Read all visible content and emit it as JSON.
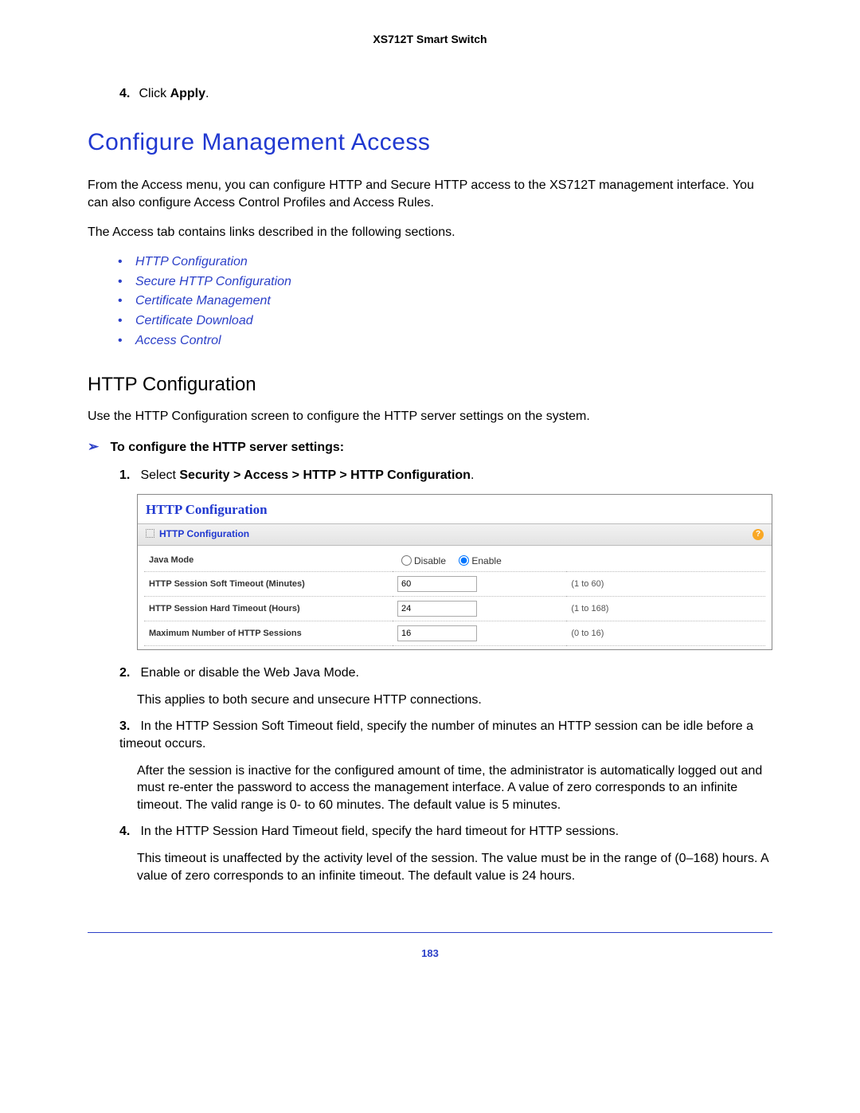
{
  "header": {
    "product": "XS712T Smart Switch"
  },
  "top_step": {
    "num": "4.",
    "prefix": "Click ",
    "bold": "Apply",
    "suffix": "."
  },
  "section_title": "Configure Management Access",
  "intro_para1": "From the Access menu, you can configure HTTP and Secure HTTP access to the XS712T management interface. You can also configure Access Control Profiles and Access Rules.",
  "intro_para2": "The Access tab contains links described in the following sections.",
  "access_links": [
    "HTTP Configuration",
    "Secure HTTP Configuration",
    "Certificate Management",
    "Certificate Download",
    "Access Control"
  ],
  "subsection_title": "HTTP Configuration",
  "sub_intro": "Use the HTTP Configuration screen to configure the HTTP server settings on the system.",
  "proc_heading": "To configure the HTTP server settings:",
  "step1": {
    "num": "1.",
    "prefix": "Select ",
    "bold": "Security > Access > HTTP > HTTP Configuration",
    "suffix": "."
  },
  "panel": {
    "title": "HTTP Configuration",
    "subtitle": "HTTP Configuration",
    "help_glyph": "?",
    "rows": {
      "java": {
        "label": "Java Mode",
        "disable": "Disable",
        "enable": "Enable",
        "selected": "enable"
      },
      "soft": {
        "label": "HTTP Session Soft Timeout (Minutes)",
        "value": "60",
        "range": "(1 to 60)"
      },
      "hard": {
        "label": "HTTP Session Hard Timeout (Hours)",
        "value": "24",
        "range": "(1 to 168)"
      },
      "max": {
        "label": "Maximum Number of HTTP Sessions",
        "value": "16",
        "range": "(0 to 16)"
      }
    }
  },
  "step2": {
    "num": "2.",
    "text": "Enable or disable the Web Java Mode."
  },
  "step2_detail": "This applies to both secure and unsecure HTTP connections.",
  "step3": {
    "num": "3.",
    "text": "In the HTTP Session Soft Timeout field, specify the number of minutes an HTTP session can be idle before a timeout occurs."
  },
  "step3_detail": "After the session is inactive for the configured amount of time, the administrator is automatically logged out and must re-enter the password to access the management interface. A value of zero corresponds to an infinite timeout. The valid range is 0- to 60 minutes. The default value is 5 minutes.",
  "step4": {
    "num": "4.",
    "text": "In the HTTP Session Hard Timeout field, specify the hard timeout for HTTP sessions."
  },
  "step4_detail": "This timeout is unaffected by the activity level of the session. The value must be in the range of (0–168) hours. A value of zero corresponds to an infinite timeout. The default value is 24 hours.",
  "page_number": "183"
}
